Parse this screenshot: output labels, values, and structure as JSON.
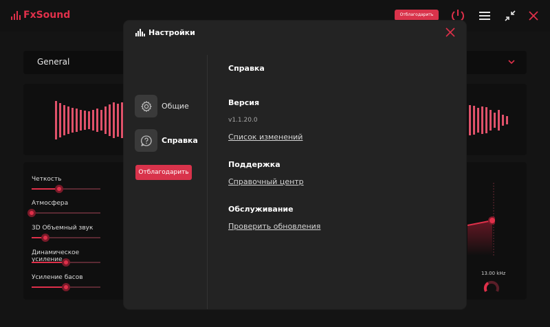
{
  "app": {
    "name": "FxSound",
    "top_thanks_label": "Отблагодарить"
  },
  "background": {
    "preset": "General",
    "effects": [
      {
        "label": "Четкость",
        "value": 0.4
      },
      {
        "label": "Атмосфера",
        "value": 0.0
      },
      {
        "label": "3D Объемный звук",
        "value": 0.2
      },
      {
        "label": "Динамическое усиление",
        "value": 0.5
      },
      {
        "label": "Усиление басов",
        "value": 0.5
      }
    ],
    "eq_freq_label": "13.00 kHz"
  },
  "modal": {
    "title": "Настройки",
    "nav": [
      {
        "label": "Общие",
        "icon": "gear-icon",
        "active": false
      },
      {
        "label": "Справка",
        "icon": "help-icon",
        "active": true
      }
    ],
    "thanks_label": "Отблагодарить",
    "help": {
      "heading": "Справка",
      "version_heading": "Версия",
      "version": "v1.1.20.0",
      "changelog_link": "Список изменений",
      "support_heading": "Поддержка",
      "help_center_link": "Справочный центр",
      "maintenance_heading": "Обслуживание",
      "check_updates_link": "Проверить обновления"
    }
  },
  "colors": {
    "accent": "#e0304a",
    "modal_bg": "#232323",
    "app_bg": "#141414"
  }
}
